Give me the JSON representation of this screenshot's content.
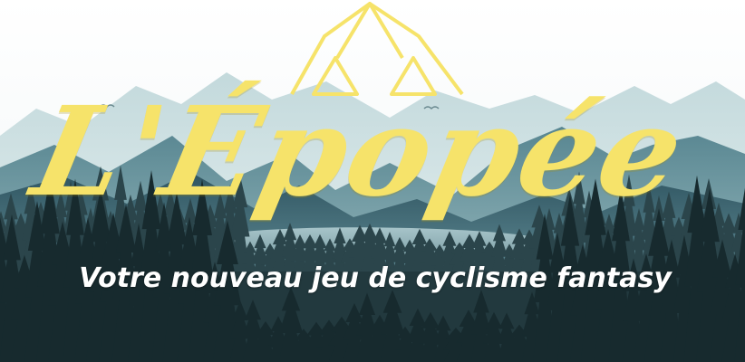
{
  "hero": {
    "title": "L'Épopée",
    "tagline": "Votre nouveau  jeu de cyclisme fantasy"
  },
  "logo": {
    "icon": "mountain-triangles-logo",
    "color": "#f6e36a"
  },
  "colors": {
    "accent_yellow": "#f6e36a",
    "forest_dark": "#1c2f33",
    "mountain_teal": "#3f6b78",
    "mountain_light": "#a9c7cc",
    "lake": "#8fb2b8",
    "text_white": "#ffffff"
  }
}
